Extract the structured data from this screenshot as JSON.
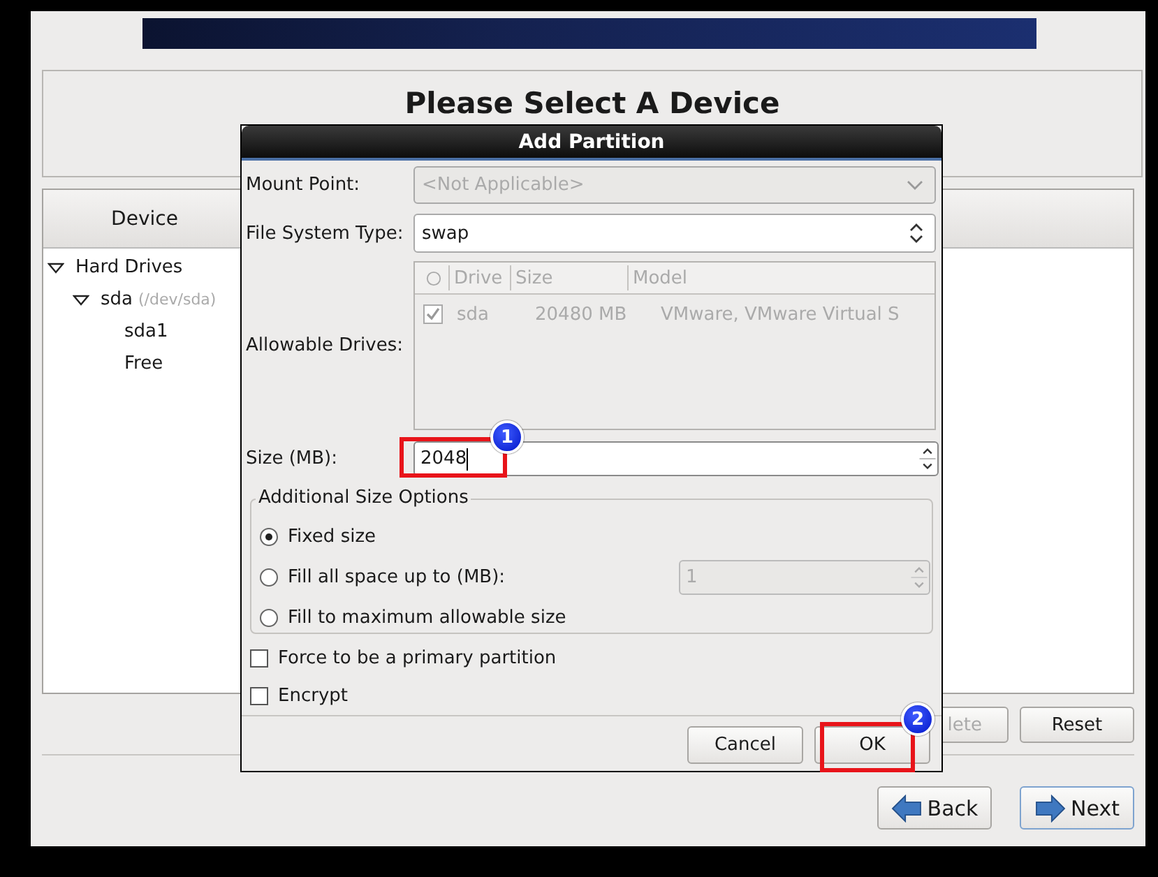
{
  "page_title": "Please Select A Device",
  "device_panel": {
    "column": "Device",
    "tree": [
      {
        "label": "Hard Drives",
        "expanded": true,
        "children": [
          {
            "label": "sda",
            "detail": "(/dev/sda)",
            "expanded": true,
            "children": [
              {
                "label": "sda1"
              },
              {
                "label": "Free"
              }
            ]
          }
        ]
      }
    ]
  },
  "panel_buttons": [
    {
      "label": "lete",
      "disabled": true
    },
    {
      "label": "Reset",
      "disabled": false
    }
  ],
  "nav_buttons": [
    {
      "label": "Back",
      "kind": "back"
    },
    {
      "label": "Next",
      "kind": "next"
    }
  ],
  "dialog": {
    "title": "Add Partition",
    "mount_point": {
      "label": "Mount Point:",
      "value": "<Not Applicable>",
      "disabled": true
    },
    "fs_type": {
      "label": "File System Type:",
      "value": "swap"
    },
    "drives": {
      "label": "Allowable Drives:",
      "columns": [
        "Drive",
        "Size",
        "Model"
      ],
      "rows": [
        {
          "checked": true,
          "drive": "sda",
          "size": "20480 MB",
          "model": "VMware, VMware Virtual S"
        }
      ]
    },
    "size": {
      "label": "Size (MB):",
      "value": "2048"
    },
    "size_options": {
      "title": "Additional Size Options",
      "options": [
        {
          "label": "Fixed size",
          "selected": true
        },
        {
          "label": "Fill all space up to (MB):",
          "selected": false,
          "value": "1"
        },
        {
          "label": "Fill to maximum allowable size",
          "selected": false
        }
      ]
    },
    "checkboxes": [
      {
        "label": "Force to be a primary partition",
        "checked": false
      },
      {
        "label": "Encrypt",
        "checked": false
      }
    ],
    "buttons": [
      {
        "label": "Cancel"
      },
      {
        "label": "OK"
      }
    ]
  },
  "annotations": [
    {
      "number": "1"
    },
    {
      "number": "2"
    }
  ]
}
